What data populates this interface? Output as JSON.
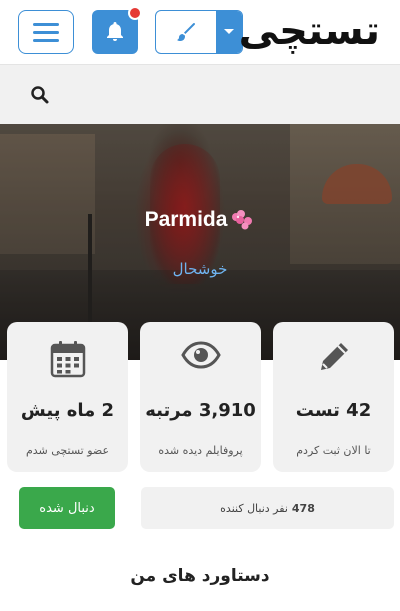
{
  "header": {
    "logo_text": "تستچی",
    "accent_color": "#3d8fd6",
    "notification_dot_color": "#e53935",
    "menu_icon": "hamburger-icon",
    "notification_icon": "bell-icon",
    "theme_icon": "paintbrush-icon",
    "theme_caret_icon": "caret-down-icon"
  },
  "search": {
    "icon": "search-icon"
  },
  "profile": {
    "name": "Parmida",
    "name_emoji": "flower-icon",
    "status": "خوشحال"
  },
  "stats": [
    {
      "icon": "calendar-icon",
      "value": "2 ماه پیش",
      "label": "عضو تستچی شدم"
    },
    {
      "icon": "eye-icon",
      "value": "3,910 مرتبه",
      "label": "پروفایلم دیده شده"
    },
    {
      "icon": "pencil-icon",
      "value": "42 تست",
      "label": "تا الان ثبت کردم"
    }
  ],
  "follow": {
    "button_label": "دنبال شده",
    "button_color": "#3aa84b",
    "followers_count": "478",
    "followers_label": "نفر دنبال کننده"
  },
  "achievements": {
    "title": "دستاورد های من"
  }
}
